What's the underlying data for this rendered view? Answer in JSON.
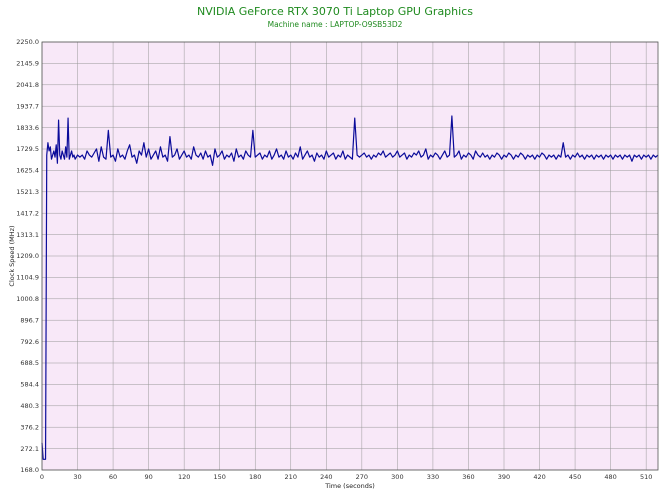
{
  "header": {
    "title": "NVIDIA GeForce RTX 3070 Ti Laptop GPU Graphics",
    "subtitle": "Machine name : LAPTOP-O9SB53D2"
  },
  "colors": {
    "title": "#1f8a1f",
    "plot_bg": "#f8e8f8",
    "grid": "#999999",
    "line": "#0b0b9a"
  },
  "chart_data": {
    "type": "line",
    "title": "NVIDIA GeForce RTX 3070 Ti Laptop GPU Graphics",
    "subtitle": "Machine name : LAPTOP-O9SB53D2",
    "xlabel": "Time (seconds)",
    "ylabel": "Clock Speed (MHz)",
    "xlim": [
      0,
      520
    ],
    "ylim": [
      168,
      2250
    ],
    "grid": true,
    "x_ticks": [
      0,
      30,
      60,
      90,
      120,
      150,
      180,
      210,
      240,
      270,
      300,
      330,
      360,
      390,
      420,
      450,
      480,
      510
    ],
    "y_ticks": [
      "168.0",
      "272.1",
      "376.2",
      "480.3",
      "584.4",
      "688.5",
      "792.6",
      "896.7",
      "1000.8",
      "1104.9",
      "1209.0",
      "1313.1",
      "1417.2",
      "1521.3",
      "1625.4",
      "1729.5",
      "1833.6",
      "1937.7",
      "2041.8",
      "2145.9",
      "2250.0"
    ],
    "series": [
      {
        "values": [
          [
            0,
            300
          ],
          [
            1,
            220
          ],
          [
            2,
            220
          ],
          [
            3,
            220
          ],
          [
            4,
            1700
          ],
          [
            5,
            1760
          ],
          [
            6,
            1720
          ],
          [
            7,
            1740
          ],
          [
            8,
            1680
          ],
          [
            9,
            1700
          ],
          [
            10,
            1720
          ],
          [
            11,
            1690
          ],
          [
            12,
            1750
          ],
          [
            13,
            1660
          ],
          [
            14,
            1870
          ],
          [
            15,
            1700
          ],
          [
            16,
            1680
          ],
          [
            17,
            1720
          ],
          [
            18,
            1700
          ],
          [
            19,
            1680
          ],
          [
            20,
            1740
          ],
          [
            21,
            1690
          ],
          [
            22,
            1880
          ],
          [
            23,
            1680
          ],
          [
            24,
            1700
          ],
          [
            25,
            1720
          ],
          [
            26,
            1690
          ],
          [
            27,
            1700
          ],
          [
            28,
            1680
          ],
          [
            30,
            1700
          ],
          [
            32,
            1690
          ],
          [
            34,
            1700
          ],
          [
            36,
            1680
          ],
          [
            38,
            1720
          ],
          [
            40,
            1700
          ],
          [
            42,
            1690
          ],
          [
            44,
            1710
          ],
          [
            46,
            1730
          ],
          [
            48,
            1670
          ],
          [
            50,
            1740
          ],
          [
            52,
            1690
          ],
          [
            54,
            1680
          ],
          [
            56,
            1820
          ],
          [
            58,
            1690
          ],
          [
            60,
            1700
          ],
          [
            62,
            1670
          ],
          [
            64,
            1730
          ],
          [
            66,
            1690
          ],
          [
            68,
            1700
          ],
          [
            70,
            1680
          ],
          [
            72,
            1720
          ],
          [
            74,
            1750
          ],
          [
            76,
            1690
          ],
          [
            78,
            1700
          ],
          [
            80,
            1660
          ],
          [
            82,
            1720
          ],
          [
            84,
            1700
          ],
          [
            86,
            1760
          ],
          [
            88,
            1690
          ],
          [
            90,
            1730
          ],
          [
            92,
            1680
          ],
          [
            94,
            1700
          ],
          [
            96,
            1720
          ],
          [
            98,
            1680
          ],
          [
            100,
            1740
          ],
          [
            102,
            1690
          ],
          [
            104,
            1700
          ],
          [
            106,
            1670
          ],
          [
            108,
            1790
          ],
          [
            110,
            1690
          ],
          [
            112,
            1700
          ],
          [
            114,
            1730
          ],
          [
            116,
            1680
          ],
          [
            118,
            1700
          ],
          [
            120,
            1720
          ],
          [
            122,
            1690
          ],
          [
            124,
            1700
          ],
          [
            126,
            1680
          ],
          [
            128,
            1740
          ],
          [
            130,
            1700
          ],
          [
            132,
            1690
          ],
          [
            134,
            1710
          ],
          [
            136,
            1680
          ],
          [
            138,
            1720
          ],
          [
            140,
            1690
          ],
          [
            142,
            1700
          ],
          [
            144,
            1650
          ],
          [
            146,
            1730
          ],
          [
            148,
            1690
          ],
          [
            150,
            1700
          ],
          [
            152,
            1720
          ],
          [
            154,
            1680
          ],
          [
            156,
            1700
          ],
          [
            158,
            1690
          ],
          [
            160,
            1710
          ],
          [
            162,
            1670
          ],
          [
            164,
            1730
          ],
          [
            166,
            1690
          ],
          [
            168,
            1700
          ],
          [
            170,
            1680
          ],
          [
            172,
            1720
          ],
          [
            174,
            1700
          ],
          [
            176,
            1690
          ],
          [
            178,
            1820
          ],
          [
            180,
            1690
          ],
          [
            182,
            1700
          ],
          [
            184,
            1710
          ],
          [
            186,
            1680
          ],
          [
            188,
            1700
          ],
          [
            190,
            1690
          ],
          [
            192,
            1720
          ],
          [
            194,
            1680
          ],
          [
            196,
            1700
          ],
          [
            198,
            1730
          ],
          [
            200,
            1690
          ],
          [
            202,
            1700
          ],
          [
            204,
            1680
          ],
          [
            206,
            1720
          ],
          [
            208,
            1690
          ],
          [
            210,
            1700
          ],
          [
            212,
            1680
          ],
          [
            214,
            1710
          ],
          [
            216,
            1690
          ],
          [
            218,
            1740
          ],
          [
            220,
            1680
          ],
          [
            222,
            1700
          ],
          [
            224,
            1720
          ],
          [
            226,
            1690
          ],
          [
            228,
            1700
          ],
          [
            230,
            1670
          ],
          [
            232,
            1710
          ],
          [
            234,
            1690
          ],
          [
            236,
            1700
          ],
          [
            238,
            1680
          ],
          [
            240,
            1720
          ],
          [
            242,
            1690
          ],
          [
            244,
            1700
          ],
          [
            246,
            1710
          ],
          [
            248,
            1680
          ],
          [
            250,
            1700
          ],
          [
            252,
            1690
          ],
          [
            254,
            1720
          ],
          [
            256,
            1680
          ],
          [
            258,
            1700
          ],
          [
            260,
            1690
          ],
          [
            262,
            1680
          ],
          [
            264,
            1880
          ],
          [
            266,
            1700
          ],
          [
            268,
            1690
          ],
          [
            270,
            1700
          ],
          [
            272,
            1710
          ],
          [
            274,
            1690
          ],
          [
            276,
            1700
          ],
          [
            278,
            1680
          ],
          [
            280,
            1700
          ],
          [
            282,
            1690
          ],
          [
            284,
            1710
          ],
          [
            286,
            1700
          ],
          [
            288,
            1720
          ],
          [
            290,
            1690
          ],
          [
            292,
            1700
          ],
          [
            294,
            1710
          ],
          [
            296,
            1690
          ],
          [
            298,
            1700
          ],
          [
            300,
            1720
          ],
          [
            302,
            1690
          ],
          [
            304,
            1700
          ],
          [
            306,
            1710
          ],
          [
            308,
            1680
          ],
          [
            310,
            1700
          ],
          [
            312,
            1690
          ],
          [
            314,
            1710
          ],
          [
            316,
            1700
          ],
          [
            318,
            1720
          ],
          [
            320,
            1690
          ],
          [
            322,
            1700
          ],
          [
            324,
            1730
          ],
          [
            326,
            1680
          ],
          [
            328,
            1700
          ],
          [
            330,
            1690
          ],
          [
            332,
            1710
          ],
          [
            334,
            1700
          ],
          [
            336,
            1680
          ],
          [
            338,
            1700
          ],
          [
            340,
            1720
          ],
          [
            342,
            1690
          ],
          [
            344,
            1700
          ],
          [
            346,
            1890
          ],
          [
            348,
            1690
          ],
          [
            350,
            1700
          ],
          [
            352,
            1720
          ],
          [
            354,
            1680
          ],
          [
            356,
            1700
          ],
          [
            358,
            1690
          ],
          [
            360,
            1710
          ],
          [
            362,
            1700
          ],
          [
            364,
            1680
          ],
          [
            366,
            1720
          ],
          [
            368,
            1700
          ],
          [
            370,
            1690
          ],
          [
            372,
            1710
          ],
          [
            374,
            1690
          ],
          [
            376,
            1700
          ],
          [
            378,
            1680
          ],
          [
            380,
            1700
          ],
          [
            382,
            1690
          ],
          [
            384,
            1710
          ],
          [
            386,
            1700
          ],
          [
            388,
            1680
          ],
          [
            390,
            1700
          ],
          [
            392,
            1690
          ],
          [
            394,
            1710
          ],
          [
            396,
            1700
          ],
          [
            398,
            1680
          ],
          [
            400,
            1700
          ],
          [
            402,
            1690
          ],
          [
            404,
            1710
          ],
          [
            406,
            1700
          ],
          [
            408,
            1680
          ],
          [
            410,
            1700
          ],
          [
            412,
            1690
          ],
          [
            414,
            1700
          ],
          [
            416,
            1680
          ],
          [
            418,
            1700
          ],
          [
            420,
            1690
          ],
          [
            422,
            1710
          ],
          [
            424,
            1700
          ],
          [
            426,
            1680
          ],
          [
            428,
            1700
          ],
          [
            430,
            1690
          ],
          [
            432,
            1700
          ],
          [
            434,
            1680
          ],
          [
            436,
            1700
          ],
          [
            438,
            1690
          ],
          [
            440,
            1760
          ],
          [
            442,
            1690
          ],
          [
            444,
            1700
          ],
          [
            446,
            1680
          ],
          [
            448,
            1700
          ],
          [
            450,
            1690
          ],
          [
            452,
            1710
          ],
          [
            454,
            1690
          ],
          [
            456,
            1700
          ],
          [
            458,
            1680
          ],
          [
            460,
            1700
          ],
          [
            462,
            1690
          ],
          [
            464,
            1700
          ],
          [
            466,
            1680
          ],
          [
            468,
            1700
          ],
          [
            470,
            1690
          ],
          [
            472,
            1700
          ],
          [
            474,
            1680
          ],
          [
            476,
            1700
          ],
          [
            478,
            1690
          ],
          [
            480,
            1700
          ],
          [
            482,
            1680
          ],
          [
            484,
            1700
          ],
          [
            486,
            1690
          ],
          [
            488,
            1700
          ],
          [
            490,
            1680
          ],
          [
            492,
            1700
          ],
          [
            494,
            1690
          ],
          [
            496,
            1700
          ],
          [
            498,
            1670
          ],
          [
            500,
            1700
          ],
          [
            502,
            1690
          ],
          [
            504,
            1700
          ],
          [
            506,
            1680
          ],
          [
            508,
            1700
          ],
          [
            510,
            1690
          ],
          [
            512,
            1700
          ],
          [
            514,
            1680
          ],
          [
            516,
            1700
          ],
          [
            518,
            1690
          ],
          [
            520,
            1700
          ]
        ]
      }
    ]
  }
}
